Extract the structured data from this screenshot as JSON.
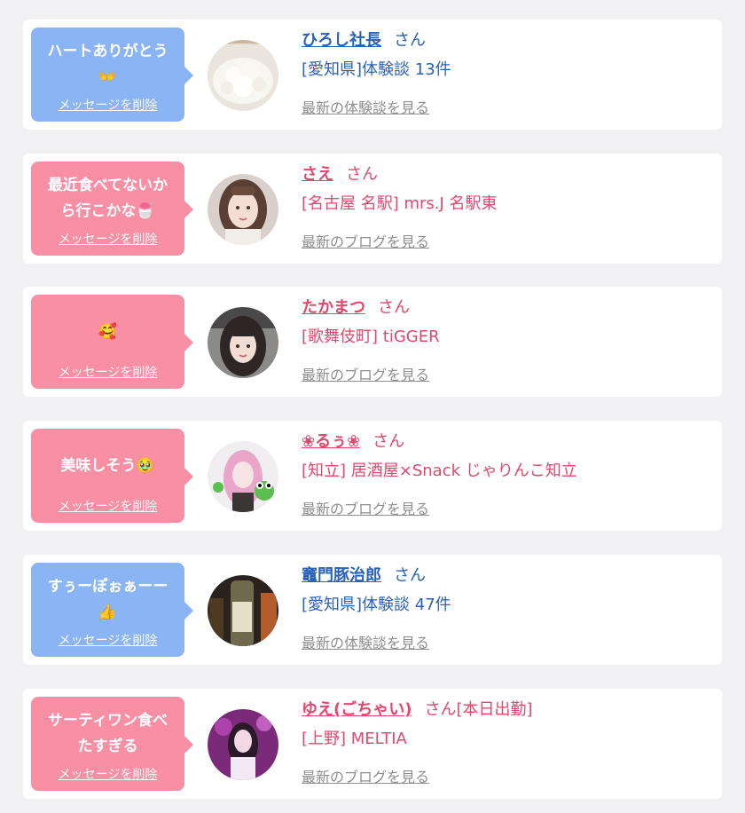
{
  "colors": {
    "blue": "#8ab4f4",
    "pink": "#f88fa4",
    "name_blue": "#2a62b8",
    "name_pink": "#e2486d"
  },
  "items": [
    {
      "theme": "blue",
      "message": "ハートありがとう\n👐",
      "delete_label": "メッセージを削除",
      "avatar_icon": "rice-bowl-avatar",
      "name": "ひろし社長",
      "suffix": "さん",
      "subtitle": "[愛知県]体験談 13件",
      "link_label": "最新の体験談を見る"
    },
    {
      "theme": "pink",
      "message": "最近食べてないか\nら行こかな🍧",
      "delete_label": "メッセージを削除",
      "avatar_icon": "woman-portrait-avatar",
      "name": "さえ",
      "suffix": "さん",
      "subtitle": "[名古屋 名駅] mrs.J 名駅東",
      "link_label": "最新のブログを見る"
    },
    {
      "theme": "pink",
      "message": "🥰",
      "delete_label": "メッセージを削除",
      "avatar_icon": "woman-portrait-avatar",
      "name": "たかまつ",
      "suffix": "さん",
      "subtitle": "[歌舞伎町] tiGGER",
      "link_label": "最新のブログを見る"
    },
    {
      "theme": "pink",
      "message": "美味しそう🥹",
      "delete_label": "メッセージを削除",
      "avatar_icon": "woman-frog-avatar",
      "name": "❀るぅ❀",
      "suffix": "さん",
      "subtitle": "[知立] 居酒屋×Snack じゃりんこ知立",
      "link_label": "最新のブログを見る"
    },
    {
      "theme": "blue",
      "message": "すぅーぽぉぁーー\n👍",
      "delete_label": "メッセージを削除",
      "avatar_icon": "bottle-avatar",
      "name": "竈門豚治郎",
      "suffix": "さん",
      "subtitle": "[愛知県]体験談 47件",
      "link_label": "最新の体験談を見る"
    },
    {
      "theme": "pink",
      "message": "サーティワン食べ\nたすぎる",
      "delete_label": "メッセージを削除",
      "avatar_icon": "woman-stage-avatar",
      "name": "ゆえ(ごちゃい)",
      "suffix": "さん[本日出勤]",
      "subtitle": "[上野] MELTIA",
      "link_label": "最新のブログを見る"
    }
  ]
}
